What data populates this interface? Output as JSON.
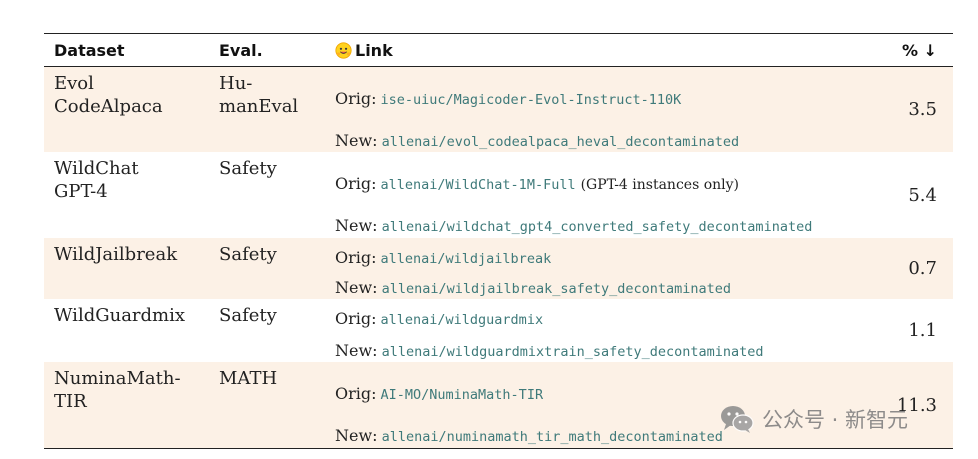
{
  "table": {
    "headers": {
      "dataset": "Dataset",
      "eval": "Eval.",
      "link": "Link",
      "pct": "% ↓"
    },
    "rows": [
      {
        "dataset_lines": [
          "Evol",
          "CodeAlpaca"
        ],
        "eval_lines": [
          "Hu-",
          "manEval"
        ],
        "orig_label": "Orig:",
        "orig_repo": "ise-uiuc/Magicoder-Evol-Instruct-110K",
        "orig_note": "",
        "new_label": "New:",
        "new_repo": "allenai/evol_codealpaca_heval_decontaminated",
        "pct": "3.5"
      },
      {
        "dataset_lines": [
          "WildChat",
          "GPT-4"
        ],
        "eval_lines": [
          "Safety"
        ],
        "orig_label": "Orig:",
        "orig_repo": "allenai/WildChat-1M-Full",
        "orig_note": "(GPT-4 instances only)",
        "new_label": "New:",
        "new_repo": "allenai/wildchat_gpt4_converted_safety_decontaminated",
        "pct": "5.4"
      },
      {
        "dataset_lines": [
          "WildJailbreak"
        ],
        "eval_lines": [
          "Safety"
        ],
        "orig_label": "Orig:",
        "orig_repo": "allenai/wildjailbreak",
        "orig_note": "",
        "new_label": "New:",
        "new_repo": "allenai/wildjailbreak_safety_decontaminated",
        "pct": "0.7"
      },
      {
        "dataset_lines": [
          "WildGuardmix"
        ],
        "eval_lines": [
          "Safety"
        ],
        "orig_label": "Orig:",
        "orig_repo": "allenai/wildguardmix",
        "orig_note": "",
        "new_label": "New:",
        "new_repo": "allenai/wildguardmixtrain_safety_decontaminated",
        "pct": "1.1"
      },
      {
        "dataset_lines": [
          "NuminaMath-",
          "TIR"
        ],
        "eval_lines": [
          "MATH"
        ],
        "orig_label": "Orig:",
        "orig_repo": "AI-MO/NuminaMath-TIR",
        "orig_note": "",
        "new_label": "New:",
        "new_repo": "allenai/numinamath_tir_math_decontaminated",
        "pct": "11.3"
      }
    ]
  },
  "watermark": {
    "icon": "wechat-icon",
    "text": "公众号 · 新智元"
  },
  "colors": {
    "shaded_row": "#fcf1e6",
    "repo_text": "#3f7a7a"
  }
}
